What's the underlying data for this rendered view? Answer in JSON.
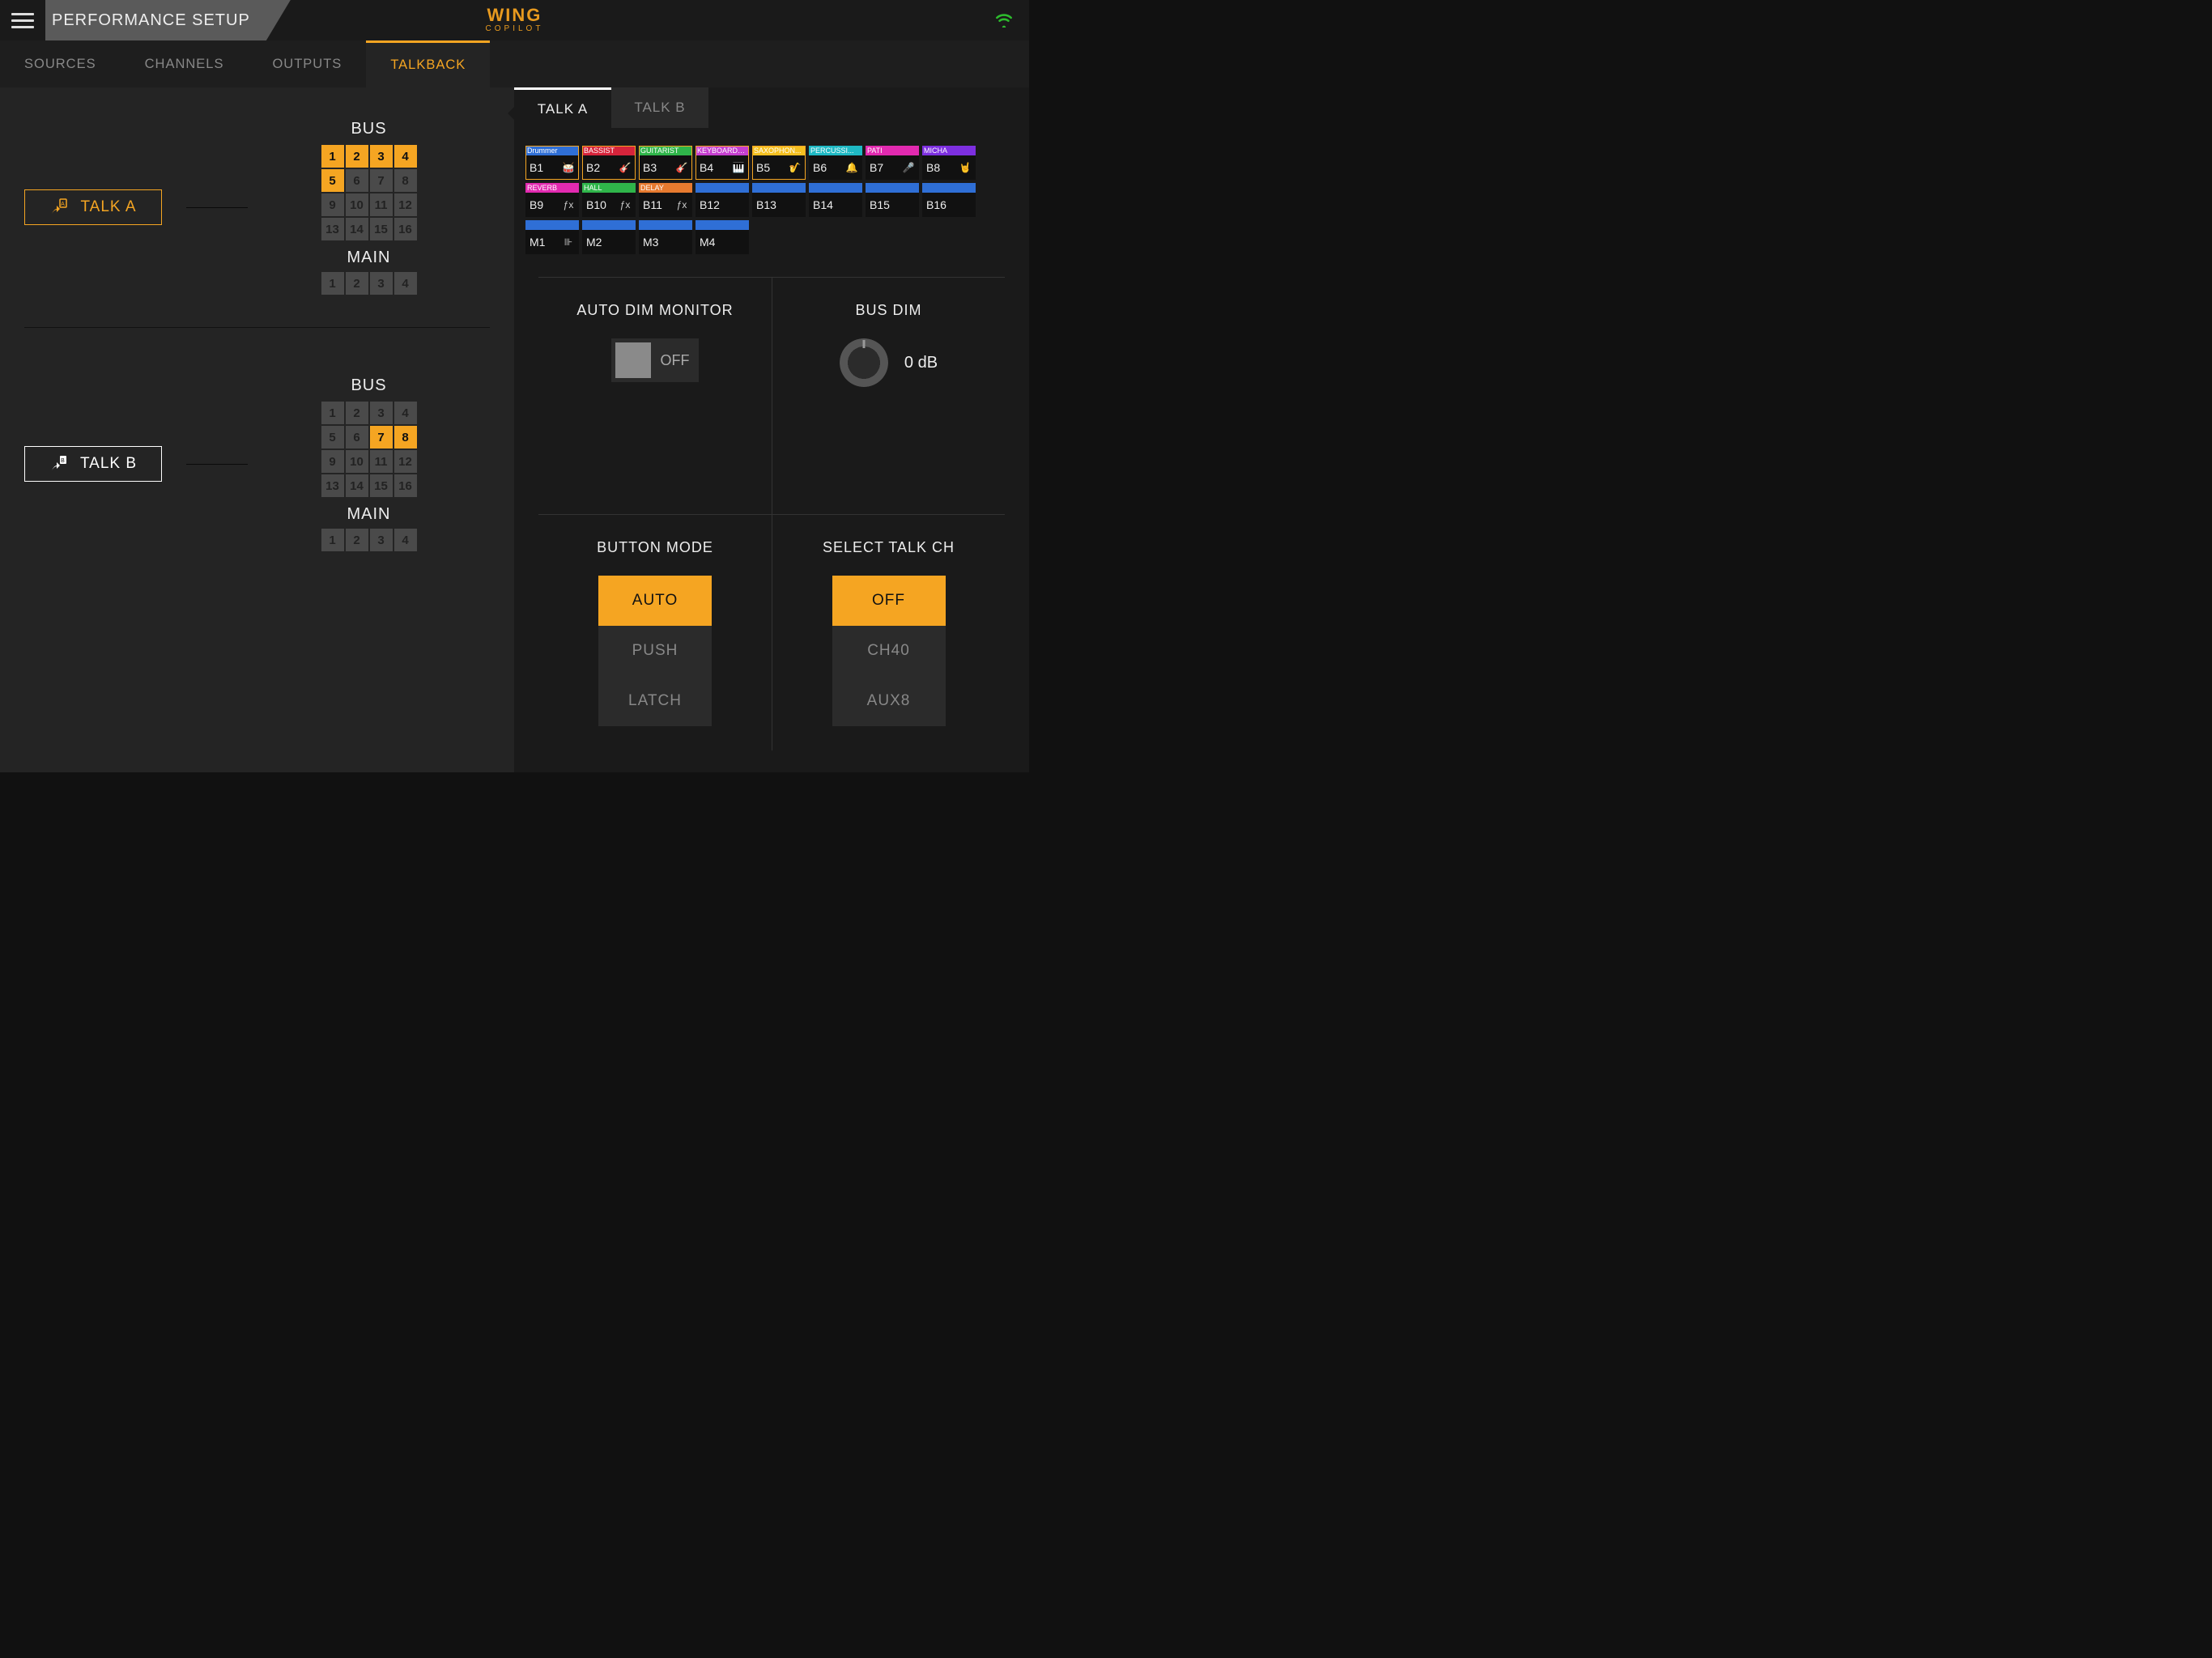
{
  "header": {
    "title": "PERFORMANCE SETUP",
    "logo_main": "WING",
    "logo_sub": "COPILOT"
  },
  "tabs": [
    {
      "label": "SOURCES",
      "active": false
    },
    {
      "label": "CHANNELS",
      "active": false
    },
    {
      "label": "OUTPUTS",
      "active": false
    },
    {
      "label": "TALKBACK",
      "active": true
    }
  ],
  "left": {
    "talkA": {
      "button": "TALK A",
      "bus_label": "BUS",
      "main_label": "MAIN",
      "bus": [
        {
          "n": "1",
          "on": true
        },
        {
          "n": "2",
          "on": true
        },
        {
          "n": "3",
          "on": true
        },
        {
          "n": "4",
          "on": true
        },
        {
          "n": "5",
          "on": true
        },
        {
          "n": "6",
          "on": false
        },
        {
          "n": "7",
          "on": false
        },
        {
          "n": "8",
          "on": false
        },
        {
          "n": "9",
          "on": false
        },
        {
          "n": "10",
          "on": false
        },
        {
          "n": "11",
          "on": false
        },
        {
          "n": "12",
          "on": false
        },
        {
          "n": "13",
          "on": false
        },
        {
          "n": "14",
          "on": false
        },
        {
          "n": "15",
          "on": false
        },
        {
          "n": "16",
          "on": false
        }
      ],
      "main": [
        {
          "n": "1",
          "on": false
        },
        {
          "n": "2",
          "on": false
        },
        {
          "n": "3",
          "on": false
        },
        {
          "n": "4",
          "on": false
        }
      ]
    },
    "talkB": {
      "button": "TALK B",
      "bus_label": "BUS",
      "main_label": "MAIN",
      "bus": [
        {
          "n": "1",
          "on": false
        },
        {
          "n": "2",
          "on": false
        },
        {
          "n": "3",
          "on": false
        },
        {
          "n": "4",
          "on": false
        },
        {
          "n": "5",
          "on": false
        },
        {
          "n": "6",
          "on": false
        },
        {
          "n": "7",
          "on": true
        },
        {
          "n": "8",
          "on": true
        },
        {
          "n": "9",
          "on": false
        },
        {
          "n": "10",
          "on": false
        },
        {
          "n": "11",
          "on": false
        },
        {
          "n": "12",
          "on": false
        },
        {
          "n": "13",
          "on": false
        },
        {
          "n": "14",
          "on": false
        },
        {
          "n": "15",
          "on": false
        },
        {
          "n": "16",
          "on": false
        }
      ],
      "main": [
        {
          "n": "1",
          "on": false
        },
        {
          "n": "2",
          "on": false
        },
        {
          "n": "3",
          "on": false
        },
        {
          "n": "4",
          "on": false
        }
      ]
    }
  },
  "right": {
    "tabs": [
      {
        "label": "TALK A",
        "active": true
      },
      {
        "label": "TALK B",
        "active": false
      }
    ],
    "targets": [
      {
        "id": "B1",
        "name": "Drummer",
        "color": "#2f6fd6",
        "selected": true,
        "icon": "drum"
      },
      {
        "id": "B2",
        "name": "BASSIST",
        "color": "#d6243b",
        "selected": true,
        "icon": "guitar"
      },
      {
        "id": "B3",
        "name": "GUITARIST",
        "color": "#2fb54a",
        "selected": true,
        "icon": "guitar"
      },
      {
        "id": "B4",
        "name": "KEYBOARDER",
        "color": "#c63fd0",
        "selected": true,
        "icon": "keys"
      },
      {
        "id": "B5",
        "name": "SAXOPHON...",
        "color": "#f5c021",
        "selected": true,
        "icon": "sax"
      },
      {
        "id": "B6",
        "name": "PERCUSSI...",
        "color": "#1fb9c4",
        "selected": false,
        "icon": "perc"
      },
      {
        "id": "B7",
        "name": "PATI",
        "color": "#e22ab0",
        "selected": false,
        "icon": "vocal"
      },
      {
        "id": "B8",
        "name": "MICHA",
        "color": "#7d2fe0",
        "selected": false,
        "icon": "rock"
      },
      {
        "id": "B9",
        "name": "REVERB",
        "color": "#e22ab0",
        "selected": false,
        "icon": "fx"
      },
      {
        "id": "B10",
        "name": "HALL",
        "color": "#2fb54a",
        "selected": false,
        "icon": "fx"
      },
      {
        "id": "B11",
        "name": "DELAY",
        "color": "#e67a2f",
        "selected": false,
        "icon": "fx"
      },
      {
        "id": "B12",
        "name": "",
        "color": "#2f6fd6",
        "selected": false,
        "icon": ""
      },
      {
        "id": "B13",
        "name": "",
        "color": "#2f6fd6",
        "selected": false,
        "icon": ""
      },
      {
        "id": "B14",
        "name": "",
        "color": "#2f6fd6",
        "selected": false,
        "icon": ""
      },
      {
        "id": "B15",
        "name": "",
        "color": "#2f6fd6",
        "selected": false,
        "icon": ""
      },
      {
        "id": "B16",
        "name": "",
        "color": "#2f6fd6",
        "selected": false,
        "icon": ""
      },
      {
        "id": "M1",
        "name": "",
        "color": "#2f6fd6",
        "selected": false,
        "icon": "main"
      },
      {
        "id": "M2",
        "name": "",
        "color": "#2f6fd6",
        "selected": false,
        "icon": ""
      },
      {
        "id": "M3",
        "name": "",
        "color": "#2f6fd6",
        "selected": false,
        "icon": ""
      },
      {
        "id": "M4",
        "name": "",
        "color": "#2f6fd6",
        "selected": false,
        "icon": ""
      }
    ],
    "autodim": {
      "title": "AUTO DIM MONITOR",
      "state": "OFF"
    },
    "busdim": {
      "title": "BUS DIM",
      "value": "0 dB"
    },
    "buttonmode": {
      "title": "BUTTON MODE",
      "options": [
        {
          "label": "AUTO",
          "on": true
        },
        {
          "label": "PUSH",
          "on": false
        },
        {
          "label": "LATCH",
          "on": false
        }
      ]
    },
    "selecttalk": {
      "title": "SELECT TALK CH",
      "options": [
        {
          "label": "OFF",
          "on": true
        },
        {
          "label": "CH40",
          "on": false
        },
        {
          "label": "AUX8",
          "on": false
        }
      ]
    }
  }
}
